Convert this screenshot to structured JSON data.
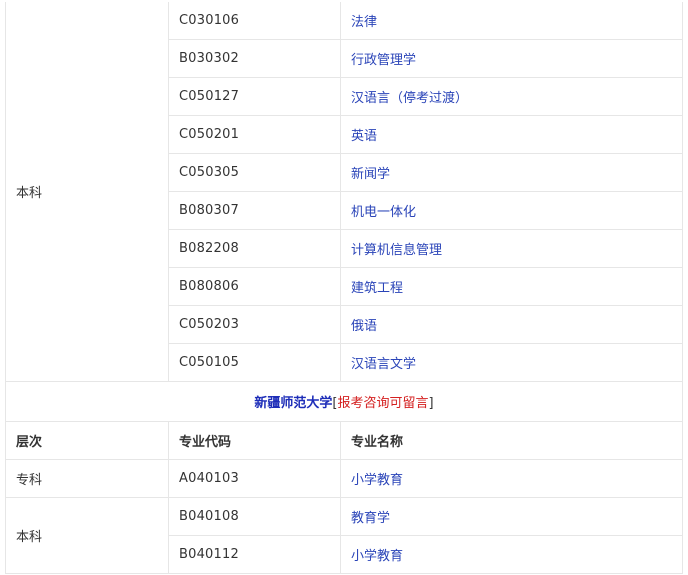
{
  "section1": {
    "level": "本科",
    "rows": [
      {
        "code": "C030106",
        "name": "法律"
      },
      {
        "code": "B030302",
        "name": "行政管理学"
      },
      {
        "code": "C050127",
        "name": "汉语言（停考过渡）"
      },
      {
        "code": "C050201",
        "name": "英语"
      },
      {
        "code": "C050305",
        "name": "新闻学"
      },
      {
        "code": "B080307",
        "name": "机电一体化"
      },
      {
        "code": "B082208",
        "name": "计算机信息管理"
      },
      {
        "code": "B080806",
        "name": "建筑工程"
      },
      {
        "code": "C050203",
        "name": "俄语"
      },
      {
        "code": "C050105",
        "name": "汉语言文学"
      }
    ]
  },
  "university": {
    "name": "新疆师范大学",
    "bracket_open": "[",
    "link": "报考咨询可留言",
    "bracket_close": "]"
  },
  "headers": {
    "level": "层次",
    "code": "专业代码",
    "name": "专业名称"
  },
  "section2": {
    "zhuanke": {
      "level": "专科",
      "rows": [
        {
          "code": "A040103",
          "name": "小学教育"
        }
      ]
    },
    "benke": {
      "level": "本科",
      "rows": [
        {
          "code": "B040108",
          "name": "教育学"
        },
        {
          "code": "B040112",
          "name": "小学教育"
        }
      ]
    }
  },
  "colors": {
    "link": "#2a44b8",
    "title": "#1d2db8",
    "accent_red": "#d42020",
    "border": "#e6e6e6"
  }
}
